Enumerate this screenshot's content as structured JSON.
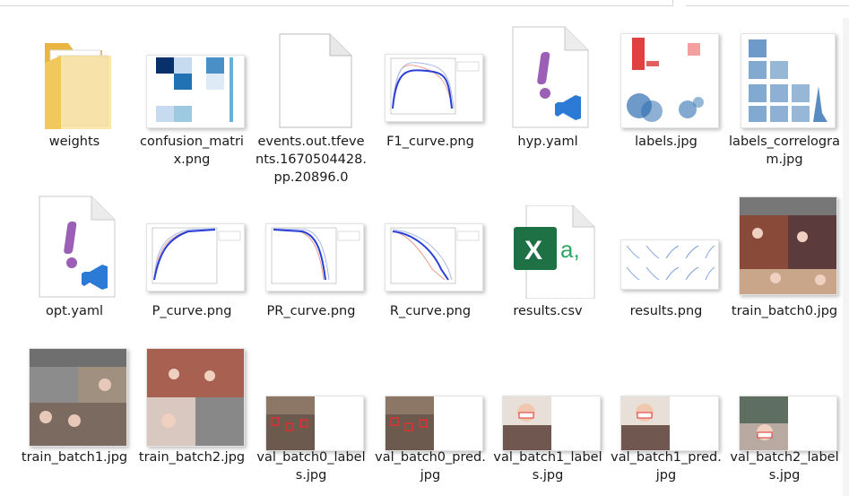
{
  "files": [
    {
      "name": "weights",
      "icon": "folder-icon"
    },
    {
      "name": "confusion_matrix.png",
      "icon": "image-thumbnail"
    },
    {
      "name": "events.out.tfevents.1670504428.pp.20896.0",
      "icon": "blank-file-icon"
    },
    {
      "name": "F1_curve.png",
      "icon": "image-thumbnail"
    },
    {
      "name": "hyp.yaml",
      "icon": "yaml-vscode-icon"
    },
    {
      "name": "labels.jpg",
      "icon": "image-thumbnail"
    },
    {
      "name": "labels_correlogram.jpg",
      "icon": "image-thumbnail"
    },
    {
      "name": "opt.yaml",
      "icon": "yaml-vscode-icon"
    },
    {
      "name": "P_curve.png",
      "icon": "image-thumbnail"
    },
    {
      "name": "PR_curve.png",
      "icon": "image-thumbnail"
    },
    {
      "name": "R_curve.png",
      "icon": "image-thumbnail"
    },
    {
      "name": "results.csv",
      "icon": "excel-csv-icon"
    },
    {
      "name": "results.png",
      "icon": "image-thumbnail"
    },
    {
      "name": "train_batch0.jpg",
      "icon": "image-thumbnail"
    },
    {
      "name": "train_batch1.jpg",
      "icon": "image-thumbnail"
    },
    {
      "name": "train_batch2.jpg",
      "icon": "image-thumbnail"
    },
    {
      "name": "val_batch0_labels.jpg",
      "icon": "image-thumbnail"
    },
    {
      "name": "val_batch0_pred.jpg",
      "icon": "image-thumbnail"
    },
    {
      "name": "val_batch1_labels.jpg",
      "icon": "image-thumbnail"
    },
    {
      "name": "val_batch1_pred.jpg",
      "icon": "image-thumbnail"
    },
    {
      "name": "val_batch2_labels.jpg",
      "icon": "image-thumbnail"
    }
  ]
}
